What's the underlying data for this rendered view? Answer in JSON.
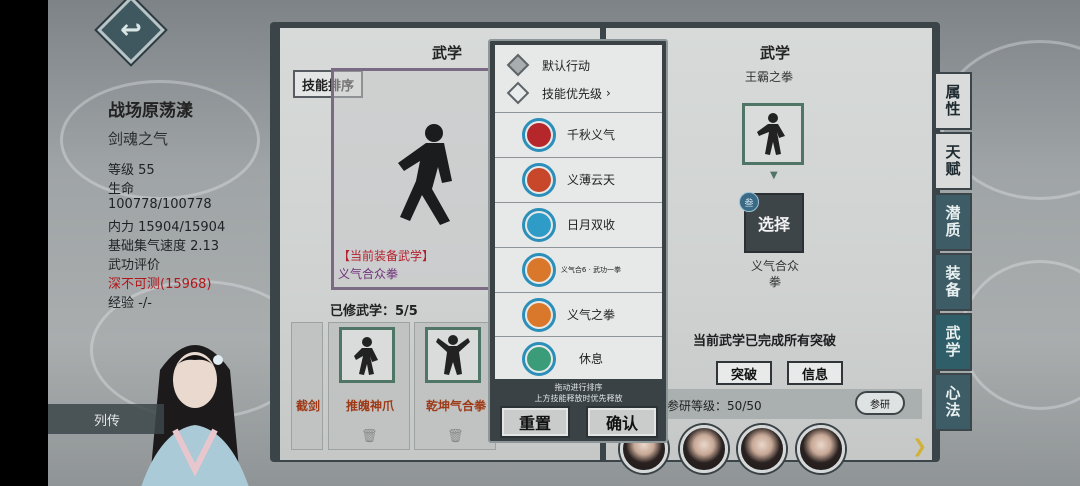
{
  "character": {
    "name": "战场原荡漾",
    "title": "剑魂之气",
    "level": "等级 55",
    "hp_label": "生命",
    "hp_value": "100778/100778",
    "mp": "内力 15904/15904",
    "speed": "基础集气速度 2.13",
    "rating_label": "武功评价",
    "rating_value": "深不可测(15968)",
    "exp": "经验 -/-",
    "bio_button": "列传"
  },
  "left_page": {
    "title": "武学",
    "sort_button": "技能排序",
    "equipped_label": "【当前装备武学】",
    "equipped_skill": "义气合众拳",
    "learned_label": "已修武学：5/5",
    "cards": [
      {
        "name": "截剑"
      },
      {
        "name": "推魄神爪"
      },
      {
        "name": "乾坤气合拳"
      }
    ]
  },
  "menu": {
    "default_action": "默认行动",
    "priority": "技能优先级",
    "skills": [
      {
        "label": "千秋义气",
        "color": "#b5272b"
      },
      {
        "label": "义薄云天",
        "color": "#c8462a"
      },
      {
        "label": "日月双收",
        "color": "#2f9cc8"
      },
      {
        "label": "义气合6 · 武功一拳",
        "color": "#d9782a"
      },
      {
        "label": "义气之拳",
        "color": "#d9782a"
      },
      {
        "label": "休息",
        "color": "#3a9c78"
      }
    ],
    "hint1": "拖动进行排序",
    "hint2": "上方技能释放时优先释放",
    "reset_button": "重置",
    "confirm_button": "确认"
  },
  "right_page": {
    "title": "武学",
    "subtitle": "王霸之拳",
    "tier_badge": "叁",
    "select_label": "选择",
    "skill_name_line1": "义气合众",
    "skill_name_line2": "拳",
    "complete_text": "当前武学已完成所有突破",
    "breakthrough_button": "突破",
    "info_button": "信息",
    "research_text": "参研等级：50/50",
    "research_button": "参研"
  },
  "tabs": [
    {
      "label": "属性"
    },
    {
      "label": "天赋"
    },
    {
      "label": "潜质"
    },
    {
      "label": "装备"
    },
    {
      "label": "武学"
    },
    {
      "label": "心法"
    }
  ],
  "colors": {
    "rating_red": "#b0171b",
    "equipped_red": "#b3212c",
    "equipped_purple": "#6e2f79",
    "tab_active": "#2f5e69"
  }
}
